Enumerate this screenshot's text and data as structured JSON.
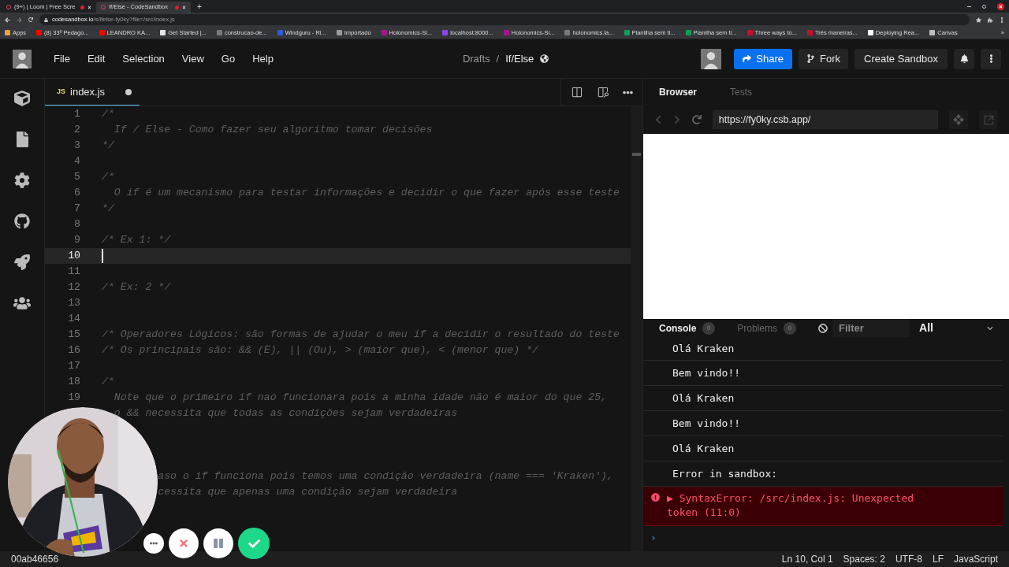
{
  "browser": {
    "tabs": [
      {
        "title": "(9+) | Loom | Free Scre",
        "selected": false,
        "recording": true
      },
      {
        "title": "If/Else - CodeSandbox",
        "selected": true,
        "recording": true
      }
    ],
    "new_tab": "+",
    "address": {
      "host": "codesandbox.io",
      "path": "/s/ifelse-fy0ky?file=/src/index.js"
    },
    "bookmarks": [
      {
        "label": "Apps",
        "color": "#e8a33d"
      },
      {
        "label": "(8) 33º Pedago...",
        "color": "#ff0000"
      },
      {
        "label": "LEANDRO KA...",
        "color": "#ff0000"
      },
      {
        "label": "Get Started |...",
        "color": "#e6e6e6"
      },
      {
        "label": "construcao-de...",
        "color": "#7a7a7a"
      },
      {
        "label": "Windguru - Ri...",
        "color": "#2f5bd8"
      },
      {
        "label": "Importado",
        "color": "#9a9a9a"
      },
      {
        "label": "Holonomics-Si...",
        "color": "#a0198c"
      },
      {
        "label": "localhost:8000...",
        "color": "#8e44ef"
      },
      {
        "label": "Holonomics-Si...",
        "color": "#a0198c"
      },
      {
        "label": "holonomics.la...",
        "color": "#7a7a7a"
      },
      {
        "label": "Planilha sem ti...",
        "color": "#0f9d58"
      },
      {
        "label": "Planilha sem ti...",
        "color": "#0f9d58"
      },
      {
        "label": "Three ways to...",
        "color": "#c8102e"
      },
      {
        "label": "Três maneiras...",
        "color": "#c8102e"
      },
      {
        "label": "Deploying Rea...",
        "color": "#ffffff"
      },
      {
        "label": "Canvas",
        "color": "#bdbdbd"
      }
    ],
    "more": "»"
  },
  "header": {
    "menu": [
      "File",
      "Edit",
      "Selection",
      "View",
      "Go",
      "Help"
    ],
    "breadcrumb": {
      "folder": "Drafts",
      "separator": "/",
      "name": "If/Else"
    },
    "share": "Share",
    "fork": "Fork",
    "create": "Create Sandbox"
  },
  "editor": {
    "tab": {
      "badge": "JS",
      "filename": "index.js",
      "modified": true
    },
    "lines": [
      {
        "number": "1",
        "text": "/*",
        "current": false
      },
      {
        "number": "2",
        "text": "  If / Else - Como fazer seu algoritmo tomar decisões",
        "current": false
      },
      {
        "number": "3",
        "text": "*/",
        "current": false
      },
      {
        "number": "4",
        "current": false
      },
      {
        "number": "5",
        "text": "/*",
        "current": false
      },
      {
        "number": "6",
        "text": "  O if é um mecanismo para testar informações e decidir o que fazer após esse teste",
        "current": false
      },
      {
        "number": "7",
        "text": "*/",
        "current": false
      },
      {
        "number": "8",
        "current": false
      },
      {
        "number": "9",
        "text": "/* Ex 1: */",
        "current": false
      },
      {
        "number": "10",
        "current": true
      },
      {
        "number": "11",
        "current": false
      },
      {
        "number": "12",
        "text": "/* Ex: 2 */",
        "current": false
      },
      {
        "number": "13",
        "current": false
      },
      {
        "number": "14",
        "current": false
      },
      {
        "number": "15",
        "text": "/* Operadores Lógicos: são formas de ajudar o meu if a decidir o resultado do teste",
        "current": false
      },
      {
        "number": "16",
        "text": "/* Os principais são: && (E), || (Ou), > (maior que), < (menor que) */",
        "current": false
      },
      {
        "number": "17",
        "current": false
      },
      {
        "number": "18",
        "text": "/*",
        "current": false
      },
      {
        "number": "19",
        "text": "  Note que o primeiro if nao funcionara pois a minha idade não é maior do que 25,",
        "current": false
      },
      {
        "text": "  o && necessita que todas as condições sejam verdadeiras",
        "current": false
      },
      {
        "current": false
      },
      {
        "current": false
      },
      {
        "current": false
      },
      {
        "text": "         aso o if funciona pois temos uma condição verdadeira (name === 'Kraken'),",
        "current": false
      },
      {
        "text": "         cessita que apenas uma condição sejam verdadeira",
        "current": false
      }
    ]
  },
  "preview": {
    "tabs": [
      {
        "label": "Browser",
        "selected": true
      },
      {
        "label": "Tests",
        "selected": false
      }
    ],
    "url": "https://fy0ky.csb.app/"
  },
  "console": {
    "tabs": [
      {
        "label": "Console",
        "count": "0",
        "selected": true
      },
      {
        "label": "Problems",
        "count": "0",
        "selected": false
      }
    ],
    "filter": {
      "placeholder": "Filter"
    },
    "level": "All",
    "messages": [
      {
        "kind": "log",
        "text": "Olá Kraken"
      },
      {
        "kind": "log",
        "text": "Bem vindo!!"
      },
      {
        "kind": "log",
        "text": "Olá Kraken"
      },
      {
        "kind": "log",
        "text": "Bem vindo!!"
      },
      {
        "kind": "log",
        "text": "Olá Kraken"
      },
      {
        "kind": "log",
        "text": "Error in sandbox:"
      },
      {
        "kind": "error",
        "expander": "▶",
        "text": "SyntaxError: /src/index.js: Unexpected token (11:0)"
      }
    ],
    "prompt": "›"
  },
  "status_bar": {
    "id": "00ab46656",
    "items": [
      "Ln 10, Col 1",
      "Spaces: 2",
      "UTF-8",
      "LF",
      "JavaScript"
    ]
  }
}
